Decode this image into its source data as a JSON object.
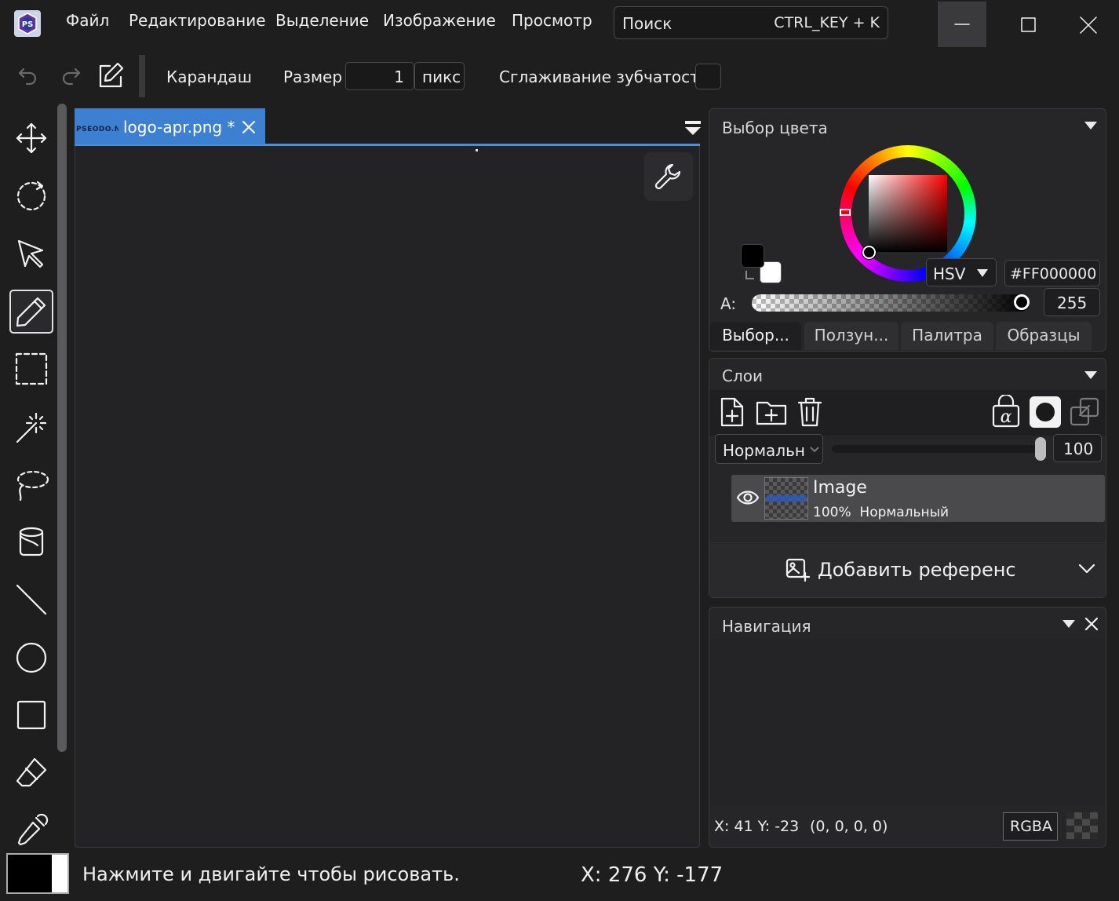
{
  "menu": [
    "Файл",
    "Редактирование",
    "Выделение",
    "Изображение",
    "Просмотр"
  ],
  "search": {
    "placeholder": "Поиск",
    "shortcut": "CTRL_KEY + K"
  },
  "app_icon": {
    "label": "PS"
  },
  "toolbar": {
    "tool_name": "Карандаш",
    "size_label": "Размер",
    "size_value": "1",
    "size_unit": "пикс",
    "antialias_label": "Сглаживание зубчатости",
    "antialias_checked": false
  },
  "tools": [
    "move-icon",
    "rotate-icon",
    "select-arrow-icon",
    "pencil-icon",
    "rect-select-icon",
    "magic-wand-icon",
    "lasso-icon",
    "bucket-icon",
    "line-icon",
    "ellipse-icon",
    "rectangle-icon",
    "eraser-icon",
    "eyedropper-icon"
  ],
  "active_tool": "pencil-icon",
  "document": {
    "tab_label": "logo-apr.png *",
    "thumb_text": "PSEODO.NET"
  },
  "color_panel": {
    "title": "Выбор цвета",
    "mode": "HSV",
    "hex": "#FF000000",
    "alpha_label": "A:",
    "alpha_value": "255",
    "primary_color": "#000000",
    "secondary_color": "#ffffff",
    "tabs": [
      "Выбор...",
      "Ползун...",
      "Палитра",
      "Образцы"
    ]
  },
  "layers_panel": {
    "title": "Слои",
    "blend_mode": "Нормальн",
    "opacity": "100",
    "layers": [
      {
        "name": "Image",
        "info": "100%  Нормальный"
      }
    ],
    "add_reference": "Добавить референс"
  },
  "navigation_panel": {
    "title": "Навигация",
    "coords": "X: 41 Y: -23",
    "pixel_value": "(0, 0, 0, 0)",
    "mode_button": "RGBA"
  },
  "status": {
    "hint": "Нажмите и двигайте чтобы рисовать.",
    "coords": "X: 276 Y: -177"
  }
}
